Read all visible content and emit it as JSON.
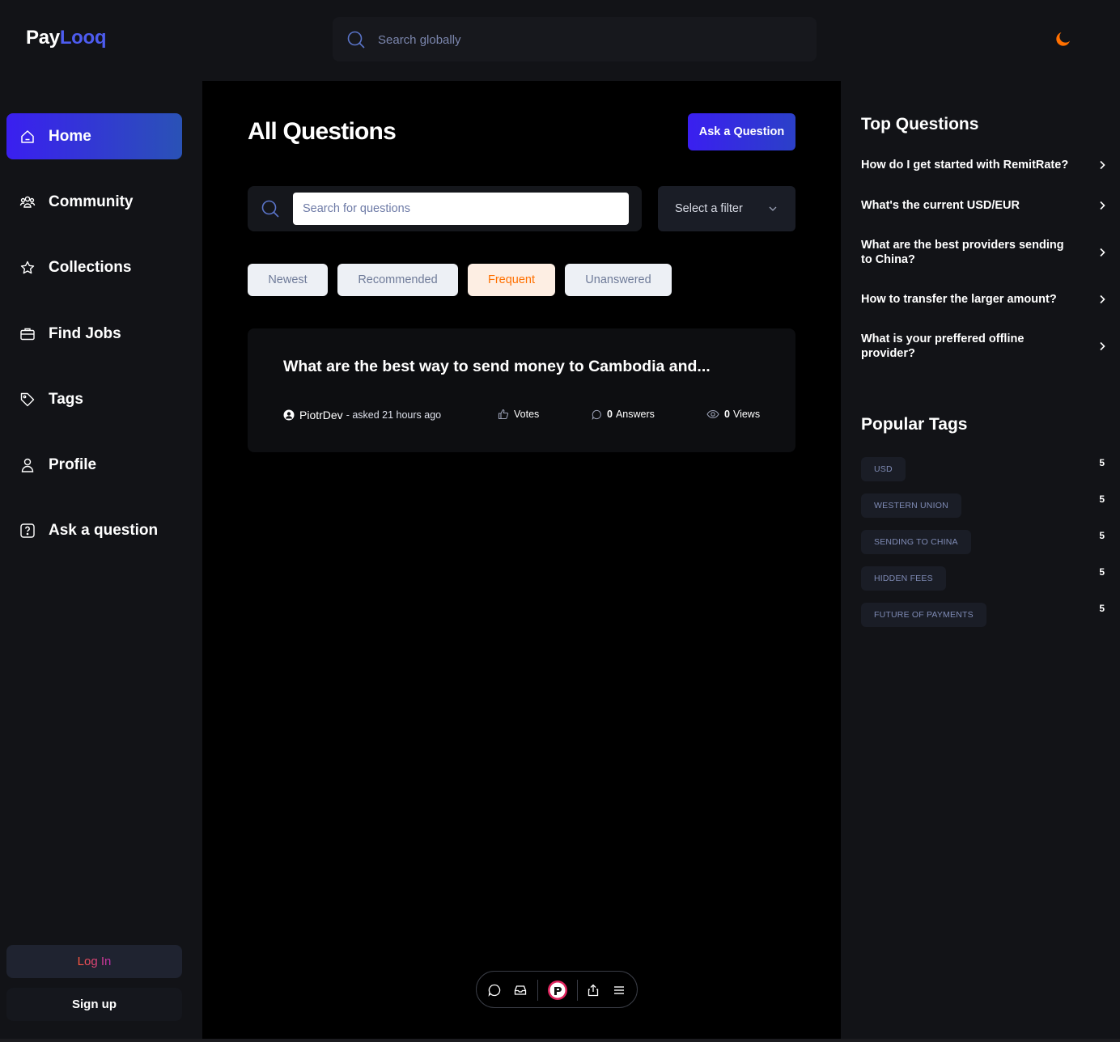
{
  "brand": {
    "part1": "Pay",
    "part2": "Looq",
    "accent": "#4d5cf0"
  },
  "header": {
    "search_placeholder": "Search globally",
    "theme_icon": "moon-icon"
  },
  "sidebar": {
    "items": [
      {
        "label": "Home",
        "icon": "home-icon",
        "active": true
      },
      {
        "label": "Community",
        "icon": "users-icon"
      },
      {
        "label": "Collections",
        "icon": "star-icon"
      },
      {
        "label": "Find Jobs",
        "icon": "briefcase-icon"
      },
      {
        "label": "Tags",
        "icon": "tag-icon"
      },
      {
        "label": "Profile",
        "icon": "user-icon"
      },
      {
        "label": "Ask a question",
        "icon": "question-icon"
      }
    ],
    "login_label": "Log In",
    "signup_label": "Sign up"
  },
  "main": {
    "title": "All Questions",
    "ask_button": "Ask a Question",
    "search_placeholder": "Search for questions",
    "filter_select": "Select a filter",
    "filters": [
      {
        "label": "Newest"
      },
      {
        "label": "Recommended"
      },
      {
        "label": "Frequent",
        "active": true
      },
      {
        "label": "Unanswered"
      }
    ],
    "questions": [
      {
        "title": "What are the best way to send money to Cambodia and...",
        "author": "PiotrDev",
        "asked": "- asked 21 hours ago",
        "votes_label": "Votes",
        "answers_count": "0",
        "answers_label": "Answers",
        "views_count": "0",
        "views_label": "Views"
      }
    ]
  },
  "right": {
    "top_title": "Top Questions",
    "top_questions": [
      "How do I get started with RemitRate?",
      "What's the current USD/EUR",
      "What are the best providers sending to China?",
      "How to transfer the larger amount?",
      "What is your preffered offline provider?"
    ],
    "tags_title": "Popular Tags",
    "tags": [
      {
        "name": "USD",
        "count": "5"
      },
      {
        "name": "WESTERN UNION",
        "count": "5"
      },
      {
        "name": "SENDING TO CHINA",
        "count": "5"
      },
      {
        "name": "HIDDEN FEES",
        "count": "5"
      },
      {
        "name": "FUTURE OF PAYMENTS",
        "count": "5"
      }
    ]
  },
  "dock": {
    "icons": [
      "comment-icon",
      "inbox-icon",
      "app-logo-icon",
      "share-icon",
      "menu-icon"
    ]
  }
}
